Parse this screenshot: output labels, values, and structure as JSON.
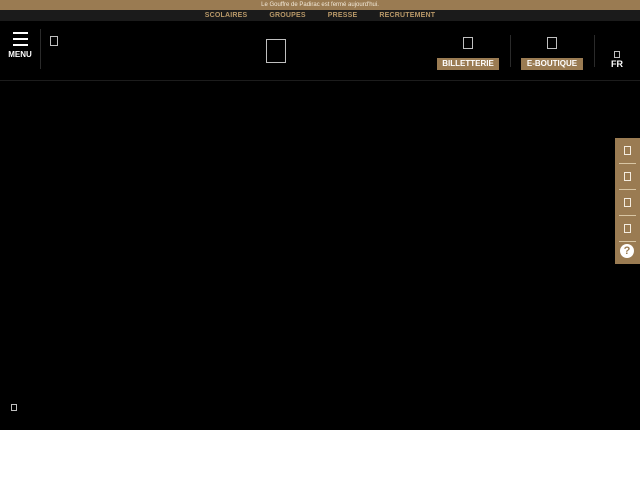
{
  "announcement": "Le Gouffre de Padirac est fermé aujourd'hui.",
  "subnav": [
    "SCOLAIRES",
    "GROUPES",
    "PRESSE",
    "RECRUTEMENT"
  ],
  "header": {
    "menu_label": "MENU",
    "billetterie_label": "BILLETTERIE",
    "eboutique_label": "E-BOUTIQUE",
    "language": "FR"
  },
  "colors": {
    "accent": "#9a7b52",
    "header_bg": "#000000",
    "subnav_bg": "#1b1b1b",
    "subnav_text": "#b89868"
  },
  "icons": {
    "search": "search-icon",
    "logo": "logo-placeholder",
    "ticket": "ticket-icon",
    "shop": "shop-icon",
    "language": "globe-icon",
    "sidebar": [
      "info-icon",
      "calendar-icon",
      "map-icon",
      "contact-icon",
      "help-icon"
    ],
    "hero": "video-control-icon"
  },
  "sidebar_help_glyph": "?"
}
